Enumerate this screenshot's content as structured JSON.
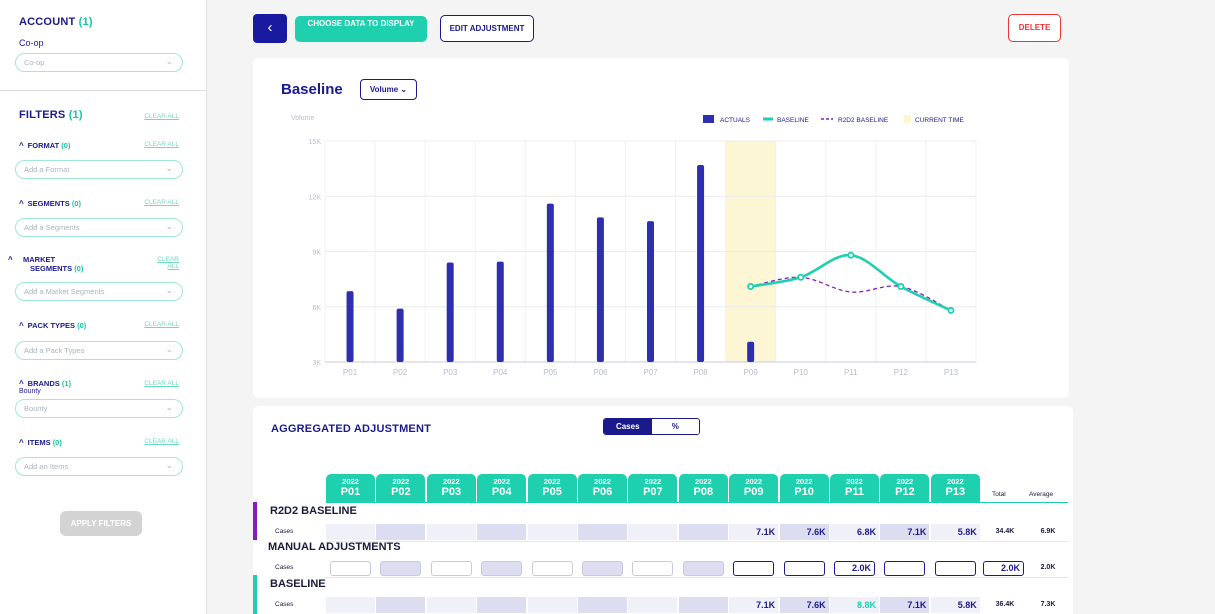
{
  "sidebar": {
    "account_title": "ACCOUNT",
    "account_count": "(1)",
    "account_value": "Co-op",
    "account_select": "Co-op",
    "filters_title": "FILTERS",
    "filters_count": "(1)",
    "clear_all": "CLEAR ALL",
    "filters": [
      {
        "label": "FORMAT",
        "count": "(0)",
        "placeholder": "Add a Format"
      },
      {
        "label": "SEGMENTS",
        "count": "(0)",
        "placeholder": "Add a Segments"
      },
      {
        "label": "MARKET SEGMENTS",
        "count": "(0)",
        "placeholder": "Add a Market Segments"
      },
      {
        "label": "PACK TYPES",
        "count": "(0)",
        "placeholder": "Add a Pack Types"
      },
      {
        "label": "BRANDS",
        "count": "(1)",
        "placeholder": "Bounty",
        "value": "Bounty"
      },
      {
        "label": "ITEMS",
        "count": "(0)",
        "placeholder": "Add an Items"
      }
    ],
    "apply_label": "APPLY FILTERS"
  },
  "toolbar": {
    "back": "‹",
    "choose_label": "CHOOSE DATA TO DISPLAY",
    "edit_label": "EDIT ADJUSTMENT",
    "delete_label": "DELETE"
  },
  "chart_card": {
    "title": "Baseline",
    "metric_select": "Volume"
  },
  "colors": {
    "navy": "#1a1a8c",
    "actuals": "#2e2eb0",
    "teal": "#1ed0ad",
    "purple": "#8a1bbf",
    "current": "#fdf6d5",
    "danger": "#e33333"
  },
  "chart_data": {
    "type": "bar",
    "ylabel": "Volume",
    "ylim": [
      3000,
      15000
    ],
    "yticks": [
      "3K",
      "6K",
      "9K",
      "12K",
      "15K"
    ],
    "categories": [
      "P01",
      "P02",
      "P03",
      "P04",
      "P05",
      "P06",
      "P07",
      "P08",
      "P09",
      "P10",
      "P11",
      "P12",
      "P13"
    ],
    "legend": [
      "ACTUALS",
      "BASELINE",
      "R2D2 BASELINE",
      "CURRENT TIME"
    ],
    "legend_position": "top-right",
    "current_time_index": 8,
    "series": [
      {
        "name": "ACTUALS",
        "type": "bar",
        "values": [
          6850,
          5900,
          8400,
          8450,
          11600,
          10850,
          10650,
          13700,
          4100,
          null,
          null,
          null,
          null
        ]
      },
      {
        "name": "BASELINE",
        "type": "line",
        "values": [
          null,
          null,
          null,
          null,
          null,
          null,
          null,
          null,
          7100,
          7600,
          8800,
          7100,
          5800
        ]
      },
      {
        "name": "R2D2 BASELINE",
        "type": "line-dashed",
        "values": [
          null,
          null,
          null,
          null,
          null,
          null,
          null,
          null,
          7100,
          7600,
          6800,
          7100,
          5800
        ]
      }
    ]
  },
  "agg": {
    "title": "AGGREGATED ADJUSTMENT",
    "toggle_cases": "Cases",
    "toggle_pct": "%",
    "year": "2022",
    "periods": [
      "P01",
      "P02",
      "P03",
      "P04",
      "P05",
      "P06",
      "P07",
      "P08",
      "P09",
      "P10",
      "P11",
      "P12",
      "P13"
    ],
    "total_label": "Total",
    "average_label": "Average",
    "row_label": "Cases",
    "r2d2": {
      "title": "R2D2 BASELINE",
      "values": [
        "",
        "",
        "",
        "",
        "",
        "",
        "",
        "",
        "7.1K",
        "7.6K",
        "6.8K",
        "7.1K",
        "5.8K"
      ],
      "total": "34.4K",
      "average": "6.9K"
    },
    "manual": {
      "title": "MANUAL ADJUSTMENTS",
      "values": [
        "",
        "",
        "",
        "",
        "",
        "",
        "",
        "",
        "",
        "",
        "2.0K",
        "",
        ""
      ],
      "total": "2.0K",
      "average": "2.0K"
    },
    "baseline": {
      "title": "BASELINE",
      "values": [
        "",
        "",
        "",
        "",
        "",
        "",
        "",
        "",
        "7.1K",
        "7.6K",
        "8.8K",
        "7.1K",
        "5.8K"
      ],
      "total": "36.4K",
      "average": "7.3K"
    }
  }
}
